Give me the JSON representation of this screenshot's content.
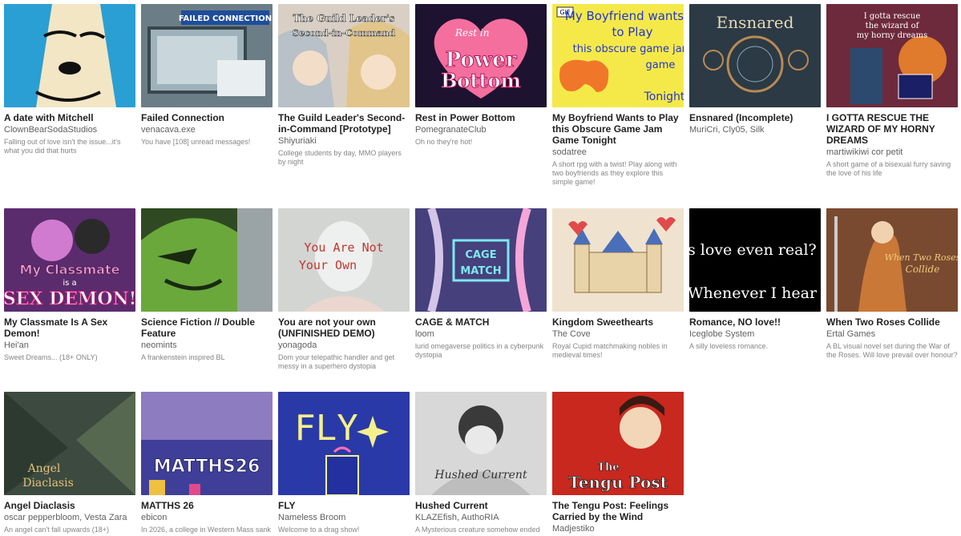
{
  "games": [
    {
      "title": "A date with Mitchell",
      "author": "ClownBearSodaStudios",
      "desc": "Falling out of love isn't the issue...it's what you did that hurts",
      "cover_icon": "cartoon-face-cover",
      "bg": "#2a9fd4",
      "cover_text": ""
    },
    {
      "title": "Failed Connection",
      "author": "venacava.exe",
      "desc": "You have [108] unread messages!",
      "cover_icon": "computer-screen-cover",
      "bg": "#6b7d86",
      "cover_text": "FAILED CONNECTION"
    },
    {
      "title": "The Guild Leader's Second-in-Command [Prototype]",
      "author": "Shiyuriaki",
      "desc": "College students by day, MMO players by night",
      "cover_icon": "anime-duo-cover",
      "bg": "#d9cfc4",
      "cover_text": "The Guild Leader's Second-in-Command"
    },
    {
      "title": "Rest in Power Bottom",
      "author": "PomegranateClub",
      "desc": "Oh no they're hot!",
      "cover_icon": "heart-logo-cover",
      "bg": "#1d1230",
      "cover_text": "Power Bottom"
    },
    {
      "title": "My Boyfriend Wants to Play this Obscure Game Jam Game Tonight",
      "author": "sodatree",
      "desc": "A short rpg with a twist! Play along with two boyfriends as they explore this simple game!",
      "cover_icon": "gamepad-cover",
      "bg": "#f5e94a",
      "cover_text": "My Boyfriend wants to Play this obscure game jam game Tonight"
    },
    {
      "title": "Ensnared (Incomplete)",
      "author": "MuriCri, Cly05, Silk",
      "desc": "",
      "cover_icon": "dreamcatcher-cover",
      "bg": "#2b3a45",
      "cover_text": "Ensnared"
    },
    {
      "title": "I GOTTA RESCUE THE WIZARD OF MY HORNY DREAMS",
      "author": "martiwikiwi cor petit",
      "desc": "A short game of a bisexual furry saving the love of his life",
      "cover_icon": "wizard-cover",
      "bg": "#8a2f3a",
      "cover_text": "I gotta rescue the wizard of my horny dreams"
    },
    {
      "title": "My Classmate Is A Sex Demon!",
      "author": "Hei'an",
      "desc": "Sweet Dreams... (18+ ONLY)",
      "cover_icon": "demon-couple-cover",
      "bg": "#5a2c6e",
      "cover_text": "My Classmate is a SEX DEMON!"
    },
    {
      "title": "Science Fiction // Double Feature",
      "author": "neomints",
      "desc": "A frankenstein inspired BL",
      "cover_icon": "green-monster-cover",
      "bg": "#2f4a22",
      "cover_text": ""
    },
    {
      "title": "You are not your own (UNFINISHED DEMO)",
      "author": "yonagoda",
      "desc": "Dom your telepathic handler and get messy in a superhero dystopia",
      "cover_icon": "pale-figure-cover",
      "bg": "#d3d5d3",
      "cover_text": "You Are Not Your Own"
    },
    {
      "title": "CAGE & MATCH",
      "author": "loom",
      "desc": "lurid omegaverse politics in a cyberpunk dystopia",
      "cover_icon": "neon-logo-cover",
      "bg": "#3c3f8a",
      "cover_text": "CAGE MATCH"
    },
    {
      "title": "Kingdom Sweethearts",
      "author": "The Cove",
      "desc": "Royal Cupid matchmaking nobles in medieval times!",
      "cover_icon": "castle-cover",
      "bg": "#efe3cf",
      "cover_text": ""
    },
    {
      "title": "Romance, NO love!!",
      "author": "Iceglobe System",
      "desc": "A silly loveless romance.",
      "cover_icon": "text-cover",
      "bg": "#000000",
      "cover_text": "s love even real? Whenever I hear a"
    },
    {
      "title": "When Two Roses Collide",
      "author": "Ertal Games",
      "desc": "A BL visual novel set during the War of the Roses. Will love prevail over honour?",
      "cover_icon": "knight-cover",
      "bg": "#6b3a25",
      "cover_text": "When Two Roses Collide"
    },
    {
      "title": "Angel Diaclasis",
      "author": "oscar pepperbloom, Vesta Zara",
      "desc": "An angel can't fall upwards (18+)",
      "cover_icon": "angel-cover",
      "bg": "#3d4a3f",
      "cover_text": "Angel Diaclasis"
    },
    {
      "title": "MATTHS 26",
      "author": "ebicon",
      "desc": "In 2026, a college in Western Mass sank",
      "cover_icon": "glitch-cover",
      "bg": "#6a5aa8",
      "cover_text": "MATTHS26"
    },
    {
      "title": "FLY",
      "author": "Nameless Broom",
      "desc": "Welcome to a drag show!",
      "cover_icon": "pixel-stars-cover",
      "bg": "#2638a6",
      "cover_text": "FLY"
    },
    {
      "title": "Hushed Current",
      "author": "KLAZEfish, AuthoRIA",
      "desc": "A Mysterious creature somehow ended",
      "cover_icon": "sketch-cover",
      "bg": "#cfcfcf",
      "cover_text": "Hushed Current"
    },
    {
      "title": "The Tengu Post: Feelings Carried by the Wind",
      "author": "Madjestiko",
      "desc": "",
      "cover_icon": "tengu-cover",
      "bg": "#c8281e",
      "cover_text": "The Tengu Post"
    }
  ]
}
